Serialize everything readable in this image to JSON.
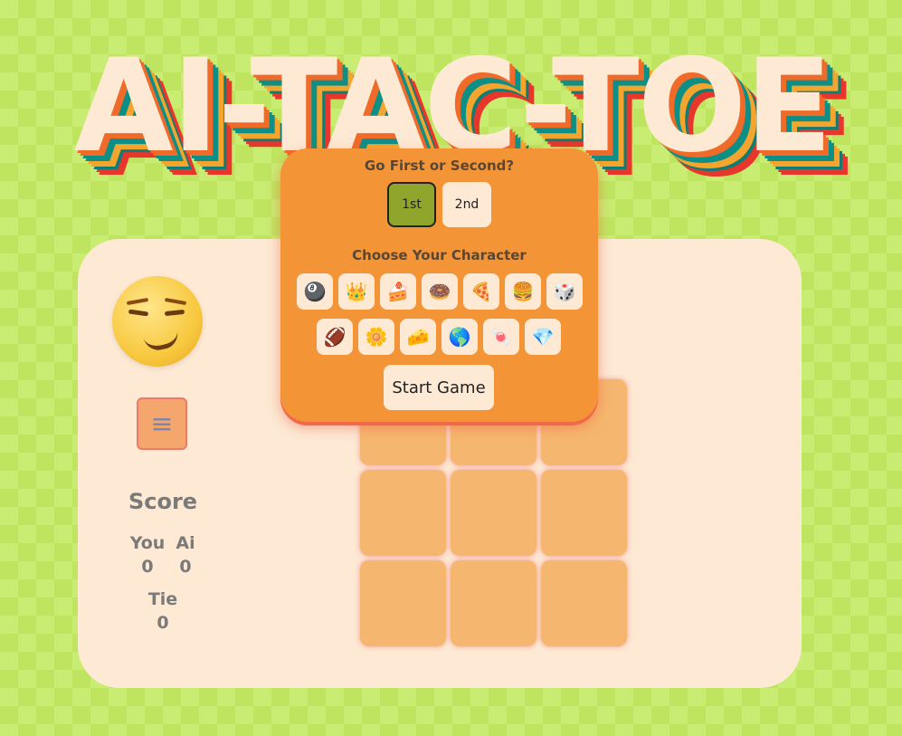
{
  "title": "AI-TAC-TOE",
  "modal": {
    "order_heading": "Go First or Second?",
    "first_label": "1st",
    "second_label": "2nd",
    "selected_order": "1st",
    "character_heading": "Choose Your Character",
    "characters": [
      "🎱",
      "👑",
      "🍰",
      "🍩",
      "🍕",
      "🍔",
      "🎲",
      "🏈",
      "🌼",
      "🧀",
      "🌎",
      "🍬",
      "💎"
    ],
    "start_label": "Start Game"
  },
  "player_avatar": "smirking-face",
  "menu_icon": "≡",
  "score": {
    "title": "Score",
    "you_label": "You",
    "you_value": "0",
    "ai_label": "Ai",
    "ai_value": "0",
    "tie_label": "Tie",
    "tie_value": "0"
  },
  "board": {
    "cells": [
      "",
      "",
      "",
      "",
      "",
      "",
      "",
      "",
      ""
    ]
  },
  "colors": {
    "background": "#c9ec72",
    "panel": "#fde9d4",
    "modal": "#f39537",
    "cell": "#f5b76f",
    "selected_button": "#8fa52c"
  }
}
